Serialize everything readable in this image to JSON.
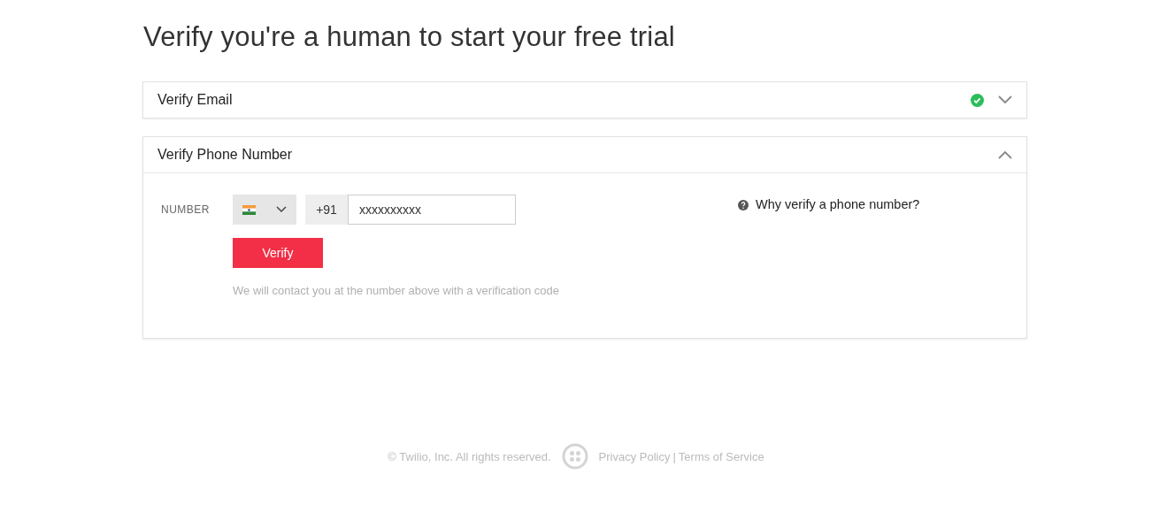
{
  "title": "Verify you're a human to start your free trial",
  "sections": [
    {
      "title": "Verify Email",
      "verified": true,
      "expanded": false
    },
    {
      "title": "Verify Phone Number",
      "verified": false,
      "expanded": true
    }
  ],
  "phone_form": {
    "label": "NUMBER",
    "dial_code": "+91",
    "number": "xxxxxxxxxx",
    "button": "Verify",
    "hint": "We will contact you at the number above with a verification code",
    "help_link": "Why verify a phone number?"
  },
  "footer": {
    "copyright": "© Twilio, Inc. All rights reserved.",
    "links": [
      "Privacy Policy",
      "Terms of Service"
    ],
    "separator": "|"
  }
}
